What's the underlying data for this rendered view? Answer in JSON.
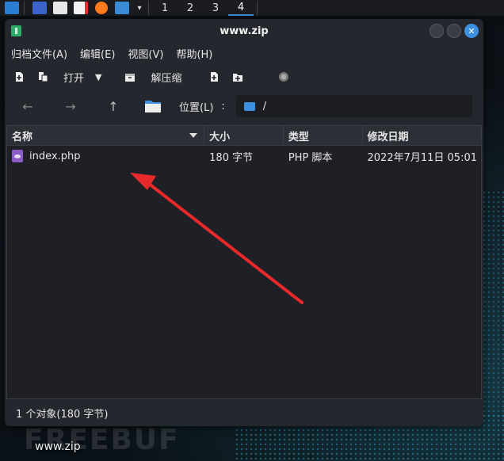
{
  "taskbar": {
    "workspaces": [
      "1",
      "2",
      "3",
      "4"
    ],
    "active_workspace": "4"
  },
  "window": {
    "title": "www.zip",
    "menu": [
      "归档文件(A)",
      "编辑(E)",
      "视图(V)",
      "帮助(H)"
    ],
    "toolbar": {
      "open_label": "打开",
      "extract_label": "解压缩"
    },
    "location": {
      "label": "位置(L)",
      "colon": ":",
      "path": "/"
    },
    "columns": [
      "名称",
      "大小",
      "类型",
      "修改日期"
    ],
    "files": [
      {
        "name": "index.php",
        "size": "180 字节",
        "type": "PHP 脚本",
        "modified": "2022年7月11日 05:01"
      }
    ],
    "status": "1 个对象(180 字节)"
  },
  "desktop": {
    "label": "www.zip",
    "watermark": "FREEBUF"
  },
  "colors": {
    "accent": "#3d8fe0",
    "arrow": "#e8292b",
    "php_icon": "#8a5cc6"
  }
}
